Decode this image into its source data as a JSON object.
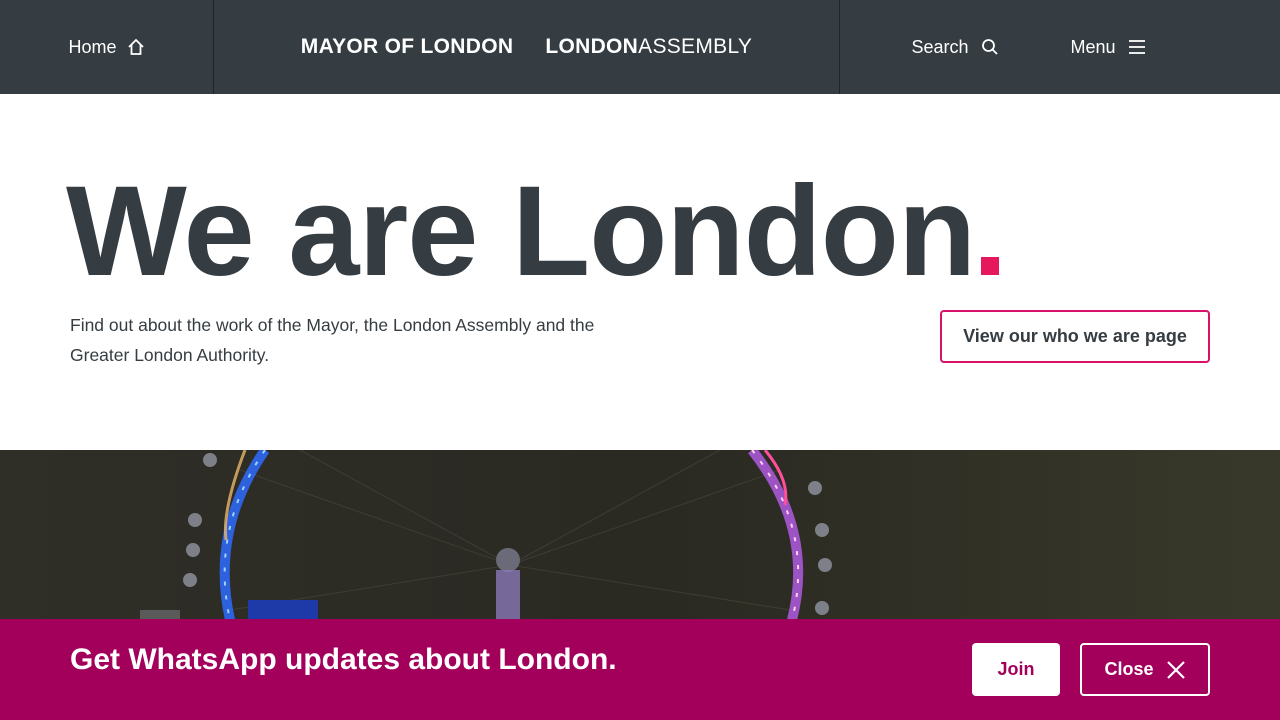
{
  "header": {
    "home_label": "Home",
    "home_icon": "home-icon",
    "brand_mayor": "MAYOR OF LONDON",
    "brand_assembly_bold": "LONDON",
    "brand_assembly_light": "ASSEMBLY",
    "search_label": "Search",
    "search_icon": "search-icon",
    "menu_label": "Menu",
    "menu_icon": "hamburger-icon"
  },
  "hero": {
    "title": "We are London",
    "accent_color": "#e5185d",
    "description": "Find out about the work of the Mayor, the London Assembly and the Greater London Authority.",
    "cta_label": "View our who we are page"
  },
  "banner": {
    "text": "Get WhatsApp updates about London.",
    "join_label": "Join",
    "close_label": "Close",
    "close_icon": "close-icon",
    "background_color": "#a3005c"
  },
  "colors": {
    "header_bg": "#353d42",
    "text": "#353d42",
    "cta_border": "#d8126b"
  }
}
